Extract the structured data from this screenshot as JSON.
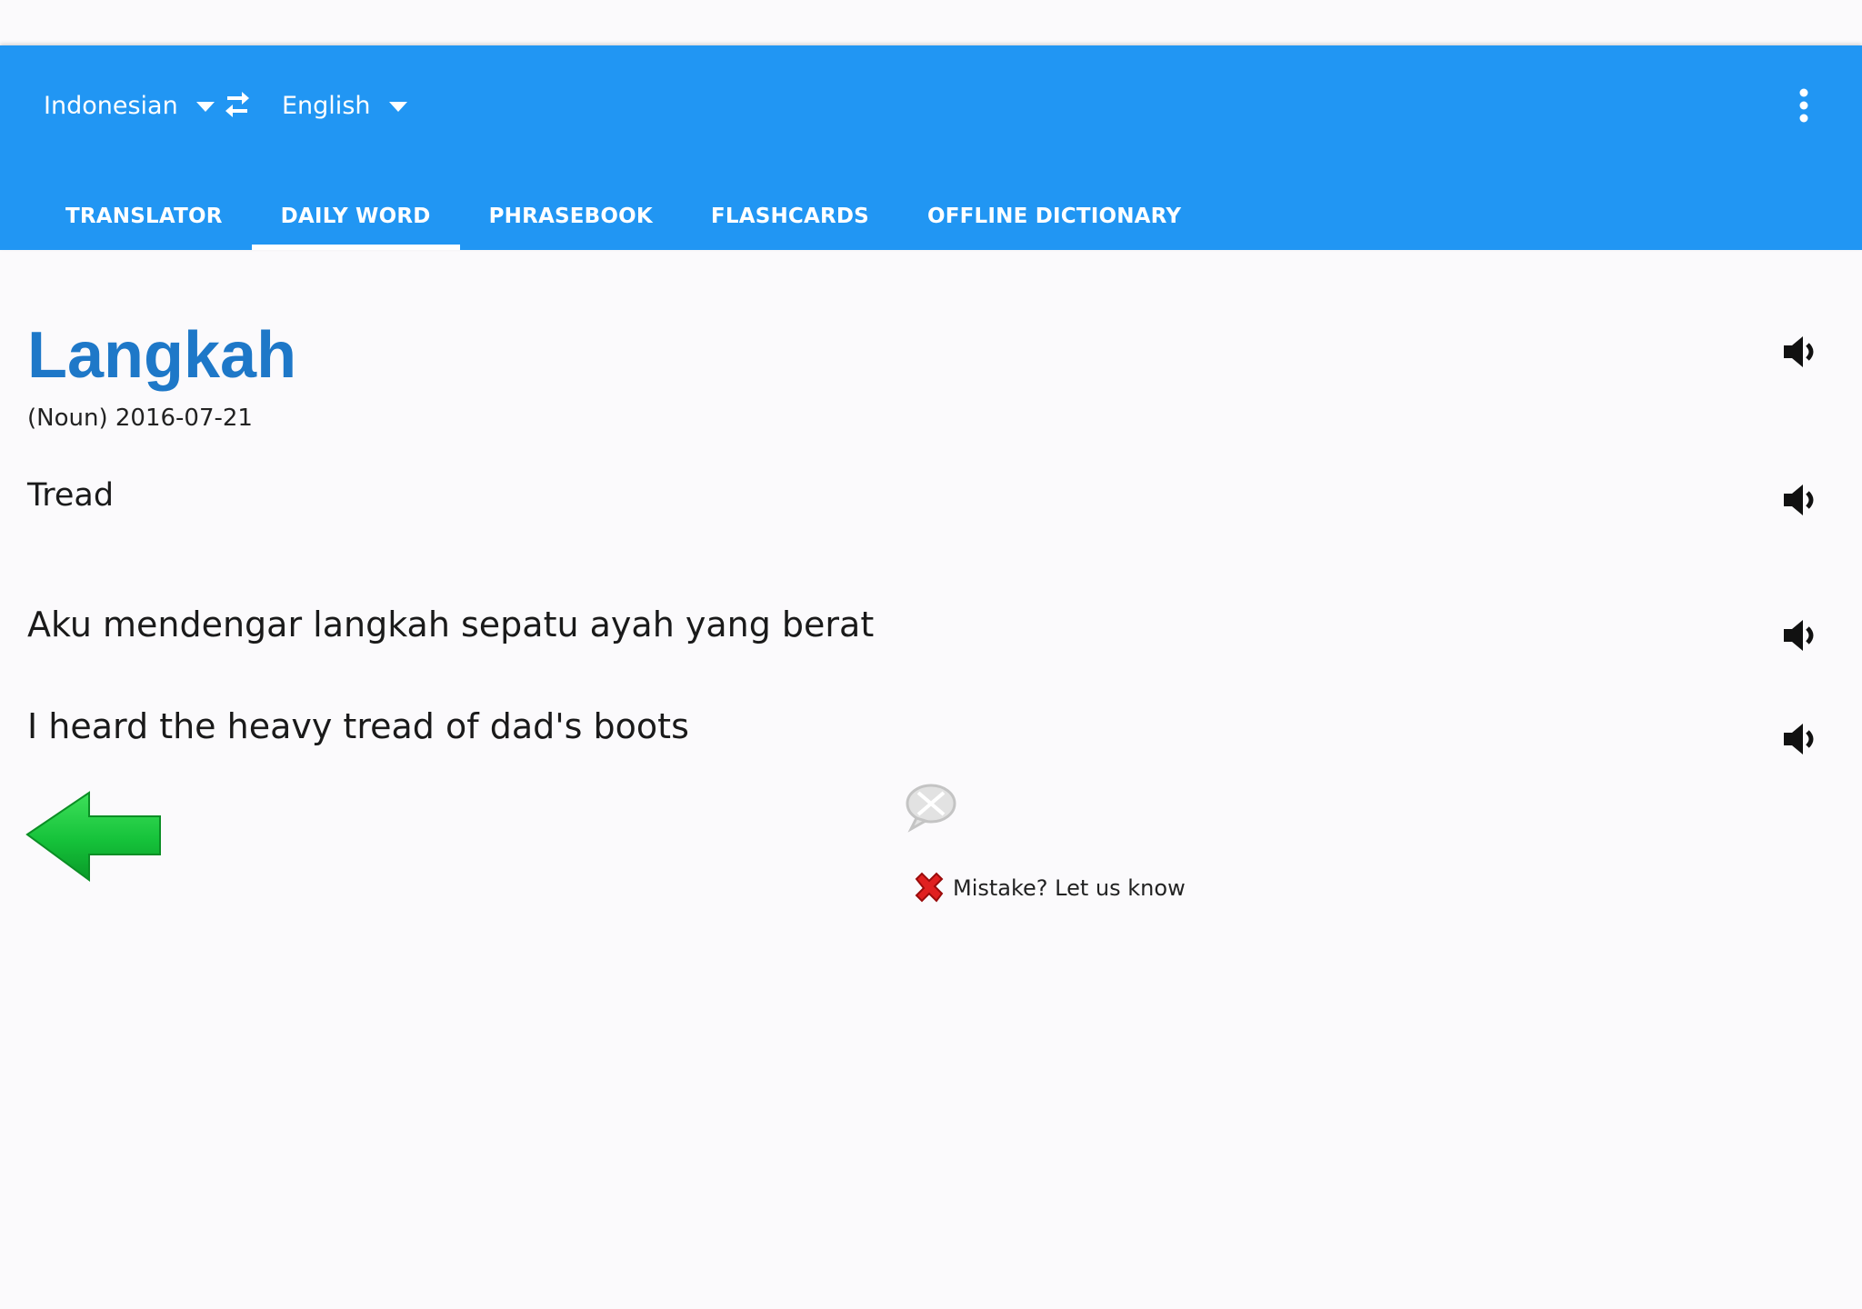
{
  "languages": {
    "source": "Indonesian",
    "target": "English"
  },
  "tabs": [
    {
      "label": "TRANSLATOR",
      "active": false
    },
    {
      "label": "DAILY WORD",
      "active": true
    },
    {
      "label": "PHRASEBOOK",
      "active": false
    },
    {
      "label": "FLASHCARDS",
      "active": false
    },
    {
      "label": "OFFLINE DICTIONARY",
      "active": false
    }
  ],
  "daily_word": {
    "word": "Langkah",
    "meta": "(Noun) 2016-07-21",
    "meaning": "Tread",
    "example_source": "Aku mendengar langkah sepatu ayah yang berat",
    "example_translation": "I heard the heavy tread of dad's boots"
  },
  "report": {
    "label": "Mistake? Let us know"
  },
  "icons": {
    "swap": "swap-languages-icon",
    "menu": "more-vert-icon",
    "speaker": "speaker-icon",
    "back": "green-back-arrow-icon",
    "chat": "chat-bubble-icon",
    "report": "red-x-icon"
  },
  "colors": {
    "app_bar": "#2196f3",
    "word": "#1e78c8",
    "background": "#fbfafc"
  }
}
